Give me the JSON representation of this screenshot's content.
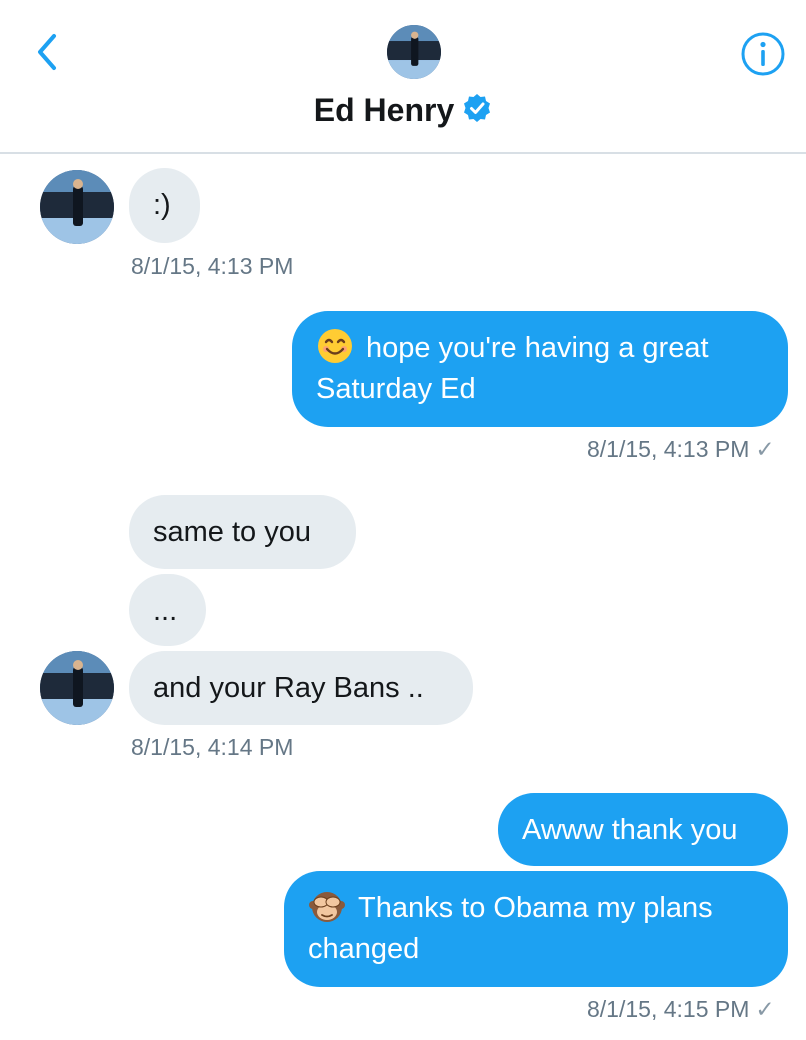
{
  "header": {
    "contact_name": "Ed Henry",
    "verified": true,
    "icons": {
      "back": "chevron-left-icon",
      "info": "info-icon",
      "verified": "verified-badge-icon"
    },
    "accent": "#1da1f2"
  },
  "messages": [
    {
      "side": "incoming",
      "text": ":)",
      "timestamp": "8/1/15, 4:13 PM"
    },
    {
      "side": "outgoing",
      "emoji": "smiling-face-emoji",
      "text": "hope you're having a great",
      "text2": "Saturday Ed",
      "timestamp": "8/1/15, 4:13 PM",
      "check": "✓"
    },
    {
      "side": "incoming",
      "text": "same to you"
    },
    {
      "side": "incoming",
      "text": "..."
    },
    {
      "side": "incoming",
      "text": "and your Ray Bans ..",
      "timestamp": "8/1/15, 4:14 PM"
    },
    {
      "side": "outgoing",
      "text": "Awww thank you"
    },
    {
      "side": "outgoing",
      "emoji": "see-no-evil-monkey-emoji",
      "text": "Thanks to Obama my plans",
      "text2": "changed",
      "timestamp": "8/1/15, 4:15 PM",
      "check": "✓"
    }
  ],
  "colors": {
    "incoming_bubble": "#e6ecf0",
    "outgoing_bubble": "#1da1f2",
    "timestamp": "#657786"
  }
}
